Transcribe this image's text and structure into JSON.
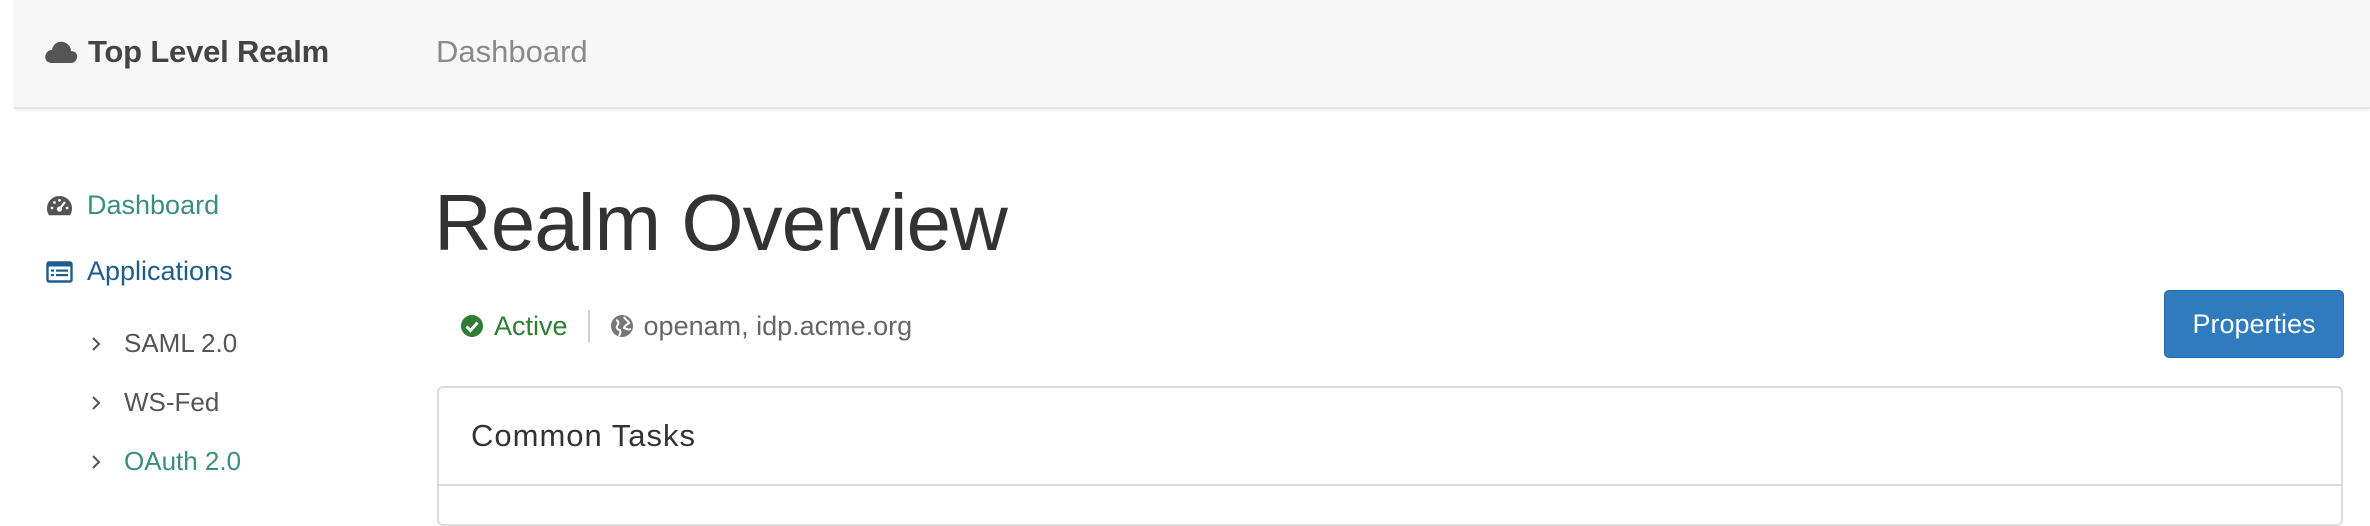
{
  "header": {
    "brand_label": "Top Level Realm",
    "brand_icon": "cloud-icon",
    "nav_dashboard": "Dashboard"
  },
  "sidebar": {
    "items": [
      {
        "label": "Dashboard",
        "icon": "dashboard-icon"
      },
      {
        "label": "Applications",
        "icon": "applications-list-icon"
      }
    ],
    "sub_items": [
      {
        "label": "SAML 2.0"
      },
      {
        "label": "WS-Fed"
      },
      {
        "label": "OAuth 2.0"
      }
    ]
  },
  "main": {
    "title": "Realm Overview",
    "status": "Active",
    "host": "openam, idp.acme.org",
    "properties_button": "Properties",
    "panel_title": "Common Tasks"
  },
  "colors": {
    "accent_green": "#3a8f7a",
    "accent_blue": "#1d5d8d",
    "status_green": "#2e7d32",
    "button_blue": "#2f7bbd"
  }
}
